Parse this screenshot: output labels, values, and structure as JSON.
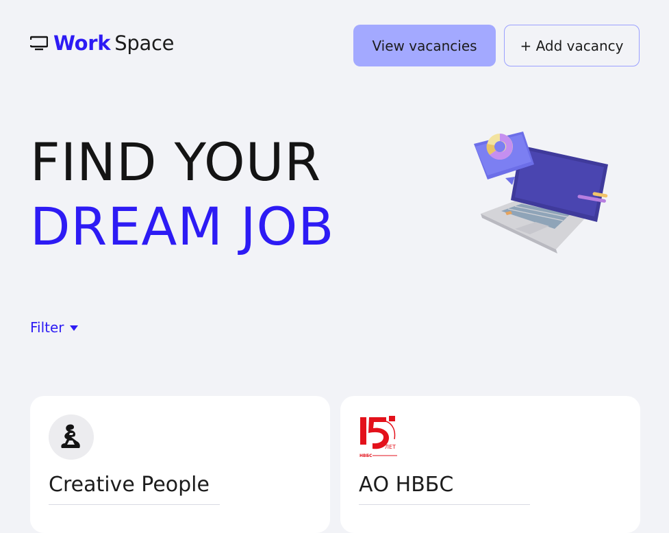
{
  "header": {
    "logo": {
      "icon": "monitor-icon",
      "work": "Work",
      "space": "Space"
    },
    "view_vacancies_label": "View vacancies",
    "add_vacancy_label": "+ Add vacancy"
  },
  "hero": {
    "line1": "FIND YOUR",
    "line2": "DREAM JOB",
    "illustration": "laptop-chart-illustration"
  },
  "filter": {
    "label": "Filter",
    "icon": "caret-down-icon"
  },
  "cards": [
    {
      "company": "Creative People",
      "logo": "creative-people-logo"
    },
    {
      "company": "АО НВБС",
      "logo": "nvbs-15-years-logo",
      "logo_text": "15 ЛЕТ НВБС"
    }
  ],
  "colors": {
    "background": "#f2f3f7",
    "accent": "#2d1bf4",
    "button_fill": "#a3a9ff",
    "button_border": "#9aa0ff",
    "card": "#ffffff"
  }
}
